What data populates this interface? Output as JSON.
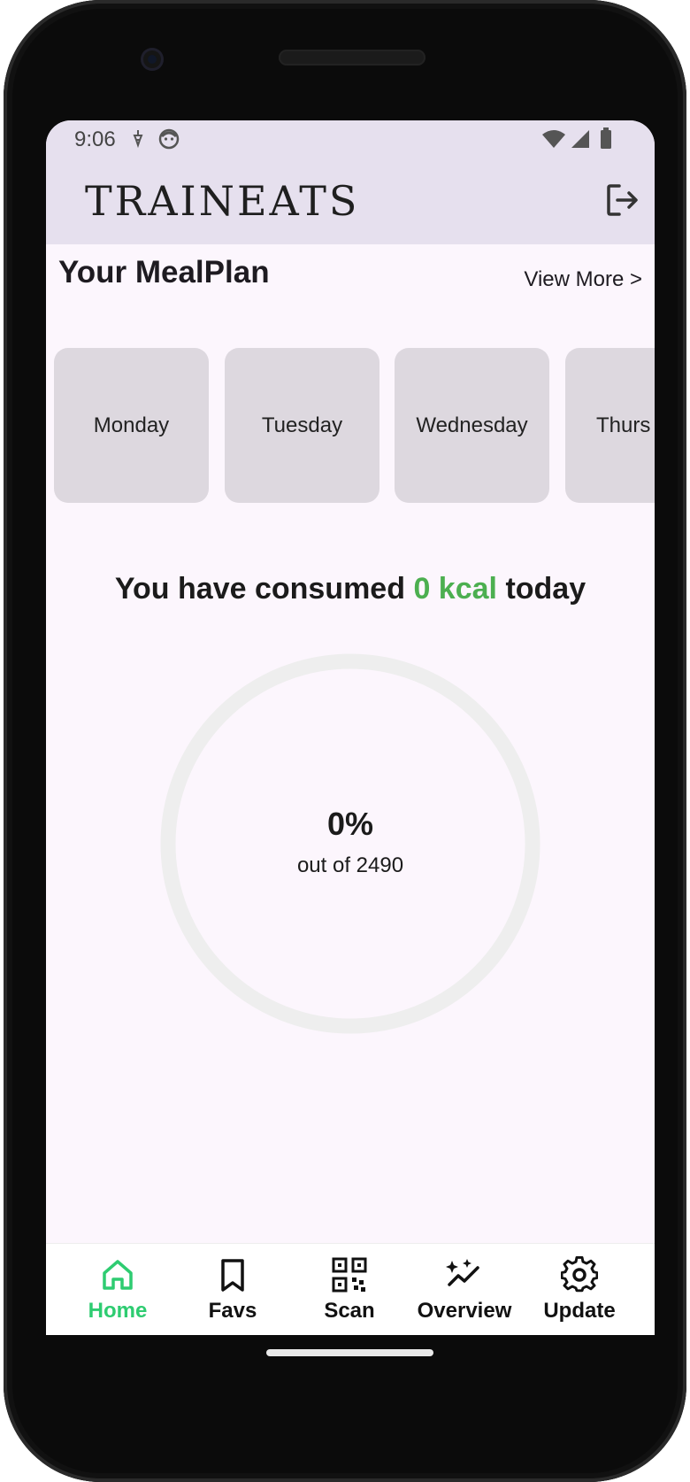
{
  "status_bar": {
    "time": "9:06"
  },
  "app_bar": {
    "title": "TRAINEATS",
    "logout_icon": "logout-icon"
  },
  "meal_plan": {
    "title": "Your MealPlan",
    "view_more": "View More >",
    "days": [
      "Monday",
      "Tuesday",
      "Wednesday",
      "Thurs"
    ]
  },
  "consumption": {
    "prefix": "You have consumed",
    "amount": "0 kcal",
    "suffix": "today",
    "percent_label": "0%",
    "percent_value": 0,
    "out_of": "out of 2490"
  },
  "bottom_nav": {
    "items": [
      {
        "label": "Home",
        "icon": "home-icon",
        "active": true
      },
      {
        "label": "Favs",
        "icon": "bookmark-icon",
        "active": false
      },
      {
        "label": "Scan",
        "icon": "qr-code-icon",
        "active": false
      },
      {
        "label": "Overview",
        "icon": "chart-sparkle-icon",
        "active": false
      },
      {
        "label": "Update",
        "icon": "gear-icon",
        "active": false
      }
    ]
  },
  "colors": {
    "accent_green": "#4caf50",
    "nav_active": "#2ecc71",
    "app_bar_bg": "#e6e0ee",
    "screen_bg": "#fcf6fd",
    "card_bg": "#ddd8df",
    "ring_track": "#eeeeee"
  }
}
